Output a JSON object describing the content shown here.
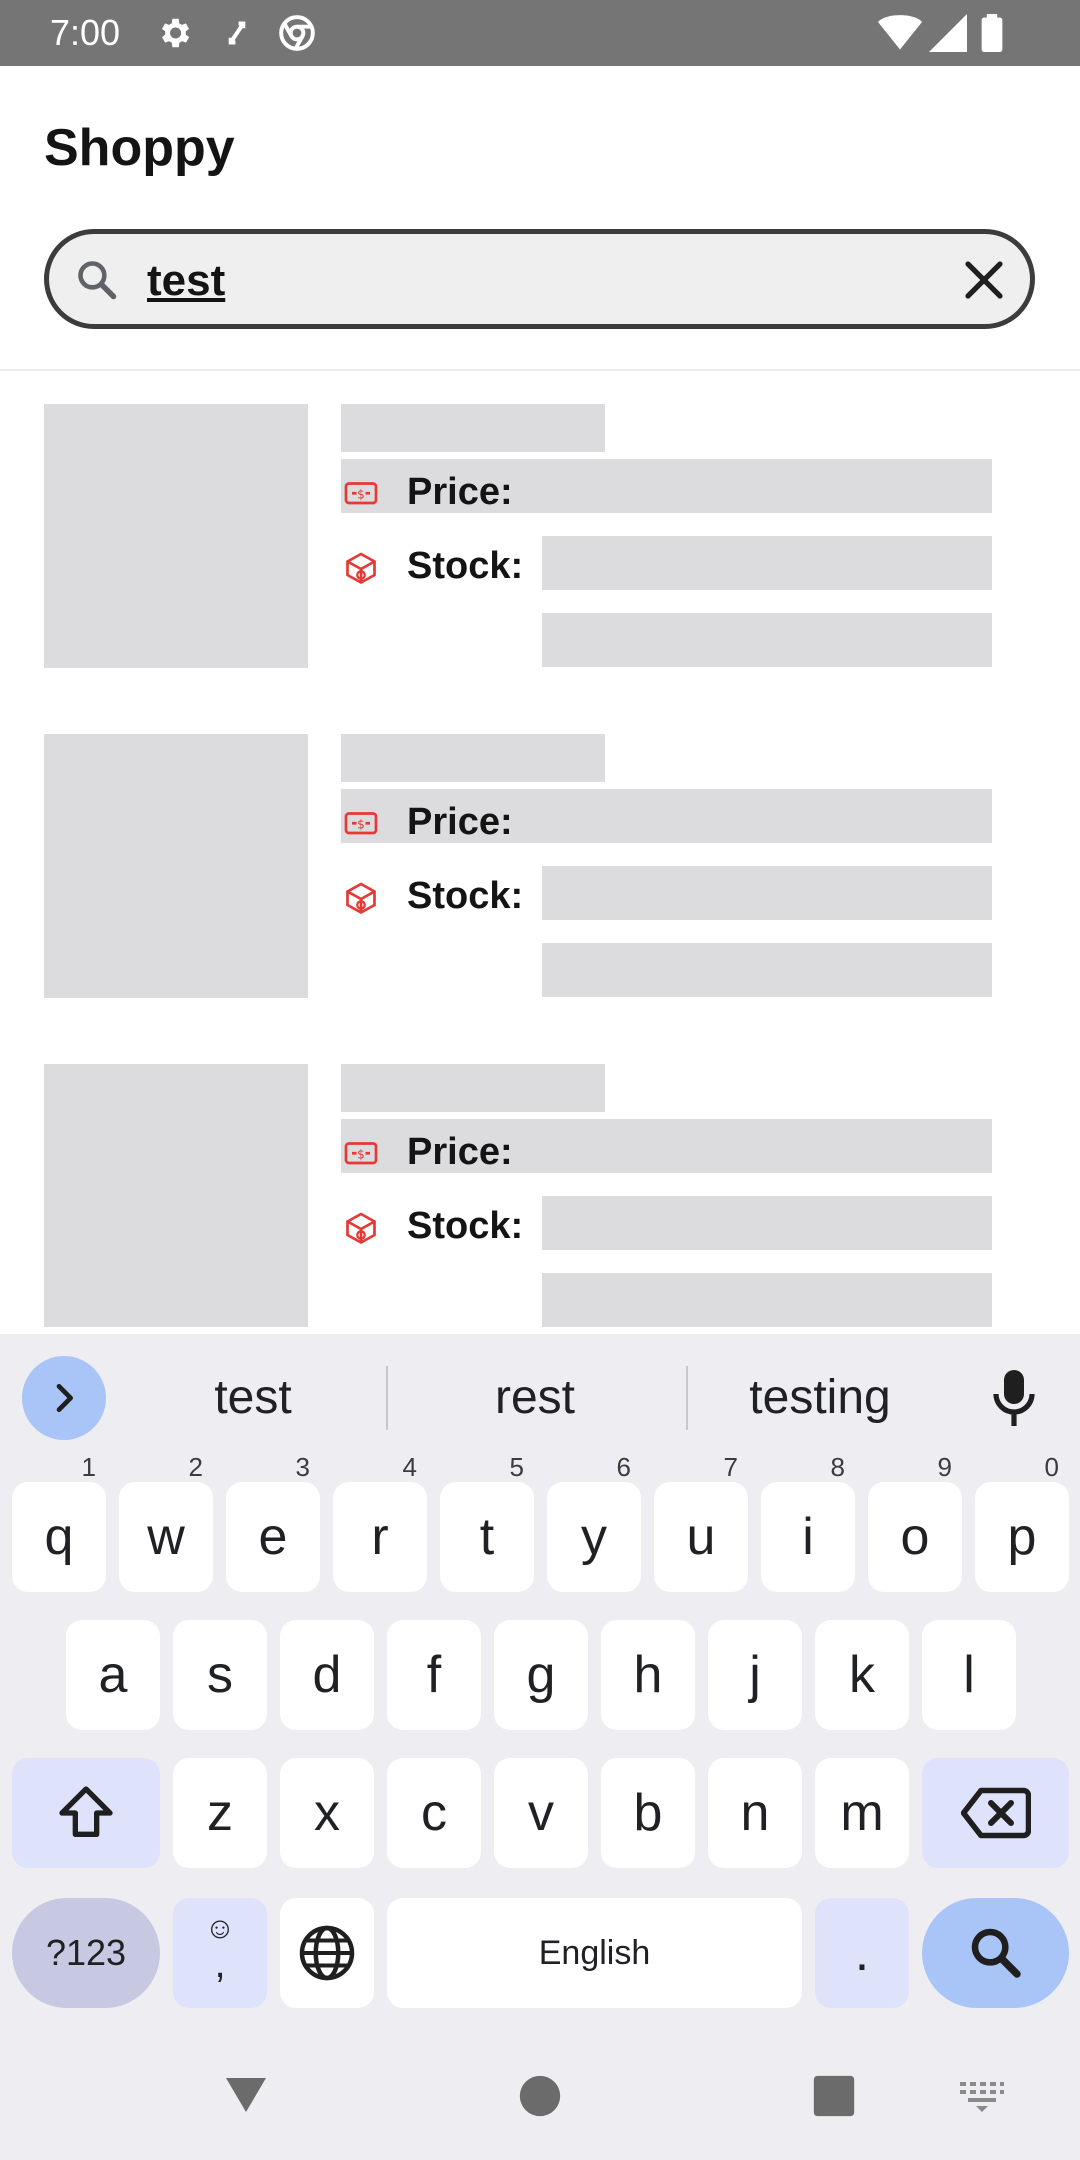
{
  "status_bar": {
    "time": "7:00",
    "left_icons": [
      "settings-icon",
      "screen-rotate-icon",
      "chrome-icon"
    ],
    "right_icons": [
      "wifi-icon",
      "signal-icon",
      "battery-icon"
    ]
  },
  "app": {
    "title": "Shoppy",
    "search": {
      "value": "test"
    }
  },
  "products": [
    {
      "price_label": "Price:",
      "stock_label": "Stock:"
    },
    {
      "price_label": "Price:",
      "stock_label": "Stock:"
    },
    {
      "price_label": "Price:",
      "stock_label": "Stock:"
    }
  ],
  "keyboard": {
    "suggestions": [
      "test",
      "rest",
      "testing"
    ],
    "row1": [
      {
        "key": "q",
        "hint": "1"
      },
      {
        "key": "w",
        "hint": "2"
      },
      {
        "key": "e",
        "hint": "3"
      },
      {
        "key": "r",
        "hint": "4"
      },
      {
        "key": "t",
        "hint": "5"
      },
      {
        "key": "y",
        "hint": "6"
      },
      {
        "key": "u",
        "hint": "7"
      },
      {
        "key": "i",
        "hint": "8"
      },
      {
        "key": "o",
        "hint": "9"
      },
      {
        "key": "p",
        "hint": "0"
      }
    ],
    "row2": [
      "a",
      "s",
      "d",
      "f",
      "g",
      "h",
      "j",
      "k",
      "l"
    ],
    "row3": [
      "z",
      "x",
      "c",
      "v",
      "b",
      "n",
      "m"
    ],
    "symbols_label": "?123",
    "emoji_top": "☺",
    "comma": ",",
    "space_label": "English",
    "period": "."
  },
  "colors": {
    "accent_icon": "#e53935",
    "skeleton": "#dcdcde",
    "keyboard_bg": "#eeeef2",
    "search_key": "#a9c4f6"
  }
}
